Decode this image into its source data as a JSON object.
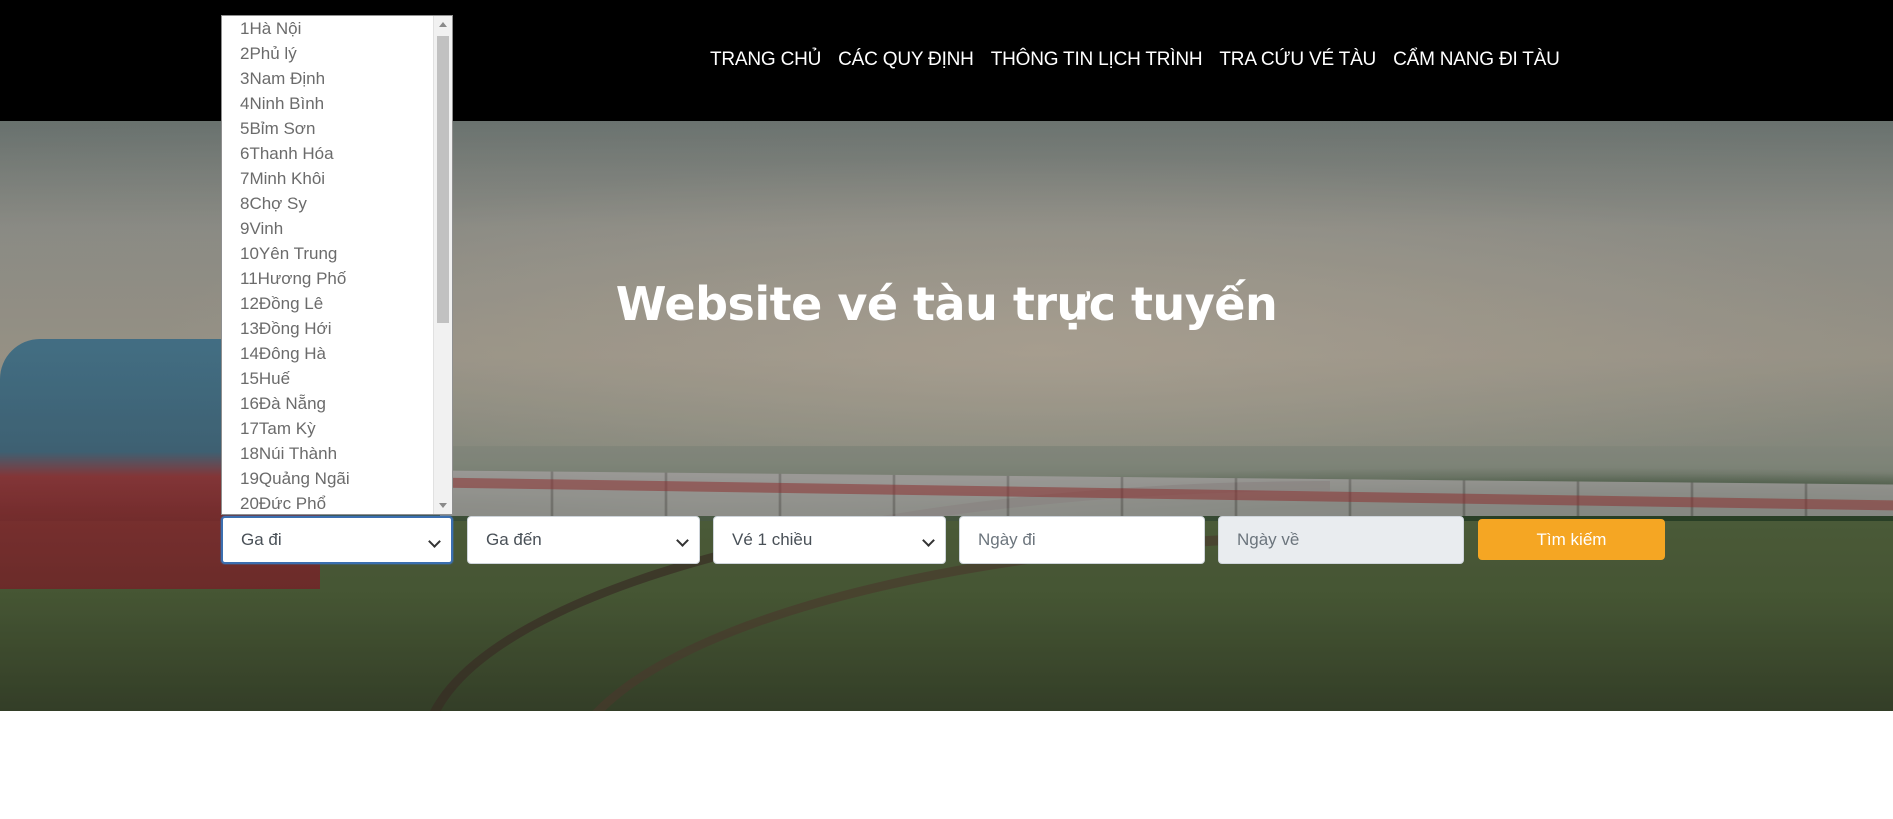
{
  "nav": {
    "items": [
      "TRANG CHỦ",
      "CÁC QUY ĐỊNH",
      "THÔNG TIN LỊCH TRÌNH",
      "TRA CỨU VÉ TÀU",
      "CẨM NANG ĐI TÀU"
    ]
  },
  "hero": {
    "title": "Website vé tàu trực tuyến"
  },
  "search": {
    "from_label": "Ga đi",
    "to_label": "Ga đến",
    "trip_type": "Vé 1 chiều",
    "depart_placeholder": "Ngày đi",
    "return_placeholder": "Ngày về",
    "submit_label": "Tìm kiếm"
  },
  "dropdown": {
    "options": [
      "1Hà Nội",
      "2Phủ lý",
      "3Nam Định",
      "4Ninh Bình",
      "5Bỉm Sơn",
      "6Thanh Hóa",
      "7Minh Khôi",
      "8Chợ Sy",
      "9Vinh",
      "10Yên Trung",
      "11Hương Phố",
      "12Đồng Lê",
      "13Đồng Hới",
      "14Đông Hà",
      "15Huế",
      "16Đà Nẵng",
      "17Tam Kỳ",
      "18Núi Thành",
      "19Quảng Ngãi",
      "20Đức Phổ"
    ]
  },
  "colors": {
    "nav_bg": "#000000",
    "accent": "#f5a623",
    "focus": "#3b6fb0"
  }
}
